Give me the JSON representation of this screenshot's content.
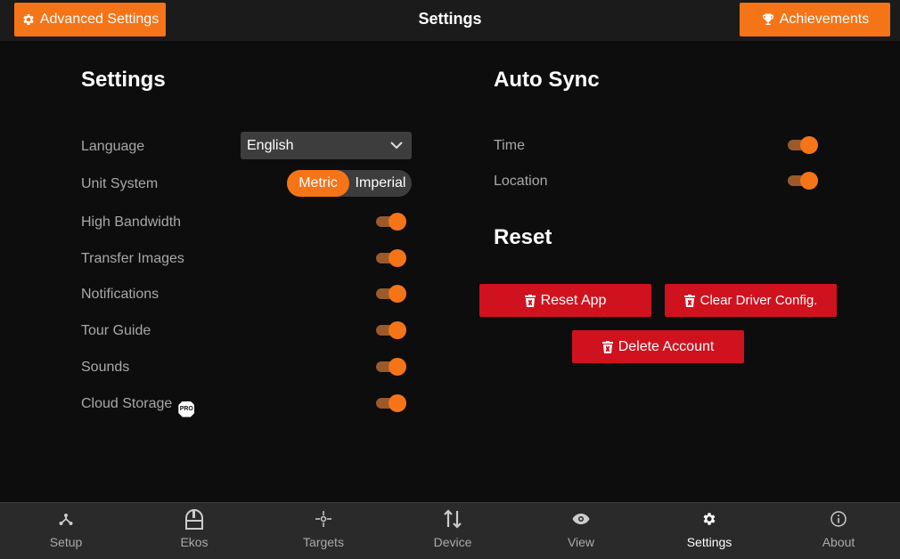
{
  "header": {
    "title": "Settings",
    "advanced_label": "Advanced Settings",
    "achievements_label": "Achievements"
  },
  "settings": {
    "title": "Settings",
    "language_label": "Language",
    "language_value": "English",
    "unit_label": "Unit System",
    "unit_options": [
      "Metric",
      "Imperial"
    ],
    "unit_selected": "Metric",
    "toggles": [
      {
        "label": "High Bandwidth",
        "on": true
      },
      {
        "label": "Transfer Images",
        "on": true
      },
      {
        "label": "Notifications",
        "on": true
      },
      {
        "label": "Tour Guide",
        "on": true
      },
      {
        "label": "Sounds",
        "on": true
      },
      {
        "label": "Cloud Storage",
        "on": true,
        "badge": "PRO"
      }
    ]
  },
  "autosync": {
    "title": "Auto Sync",
    "items": [
      {
        "label": "Time",
        "on": true
      },
      {
        "label": "Location",
        "on": true
      }
    ]
  },
  "reset": {
    "title": "Reset",
    "reset_app": "Reset App",
    "clear_driver": "Clear Driver Config.",
    "delete_account": "Delete Account"
  },
  "nav": {
    "items": [
      {
        "label": "Setup",
        "icon": "setup-icon"
      },
      {
        "label": "Ekos",
        "icon": "ekos-icon"
      },
      {
        "label": "Targets",
        "icon": "targets-icon"
      },
      {
        "label": "Device",
        "icon": "device-icon"
      },
      {
        "label": "View",
        "icon": "eye-icon"
      },
      {
        "label": "Settings",
        "icon": "gear-icon"
      },
      {
        "label": "About",
        "icon": "info-icon"
      }
    ],
    "active": "Settings"
  },
  "colors": {
    "accent": "#f57418",
    "danger": "#d0121f",
    "background": "#0d0d0d",
    "bar": "#1b1b1b"
  }
}
